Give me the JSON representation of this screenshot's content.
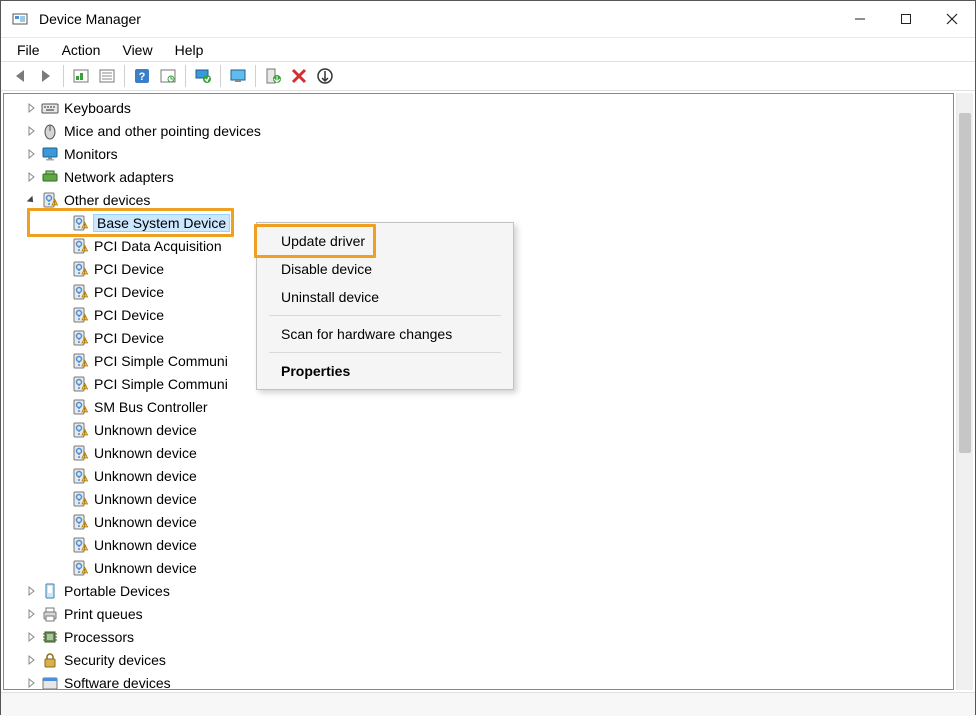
{
  "window": {
    "title": "Device Manager"
  },
  "menu": {
    "items": [
      "File",
      "Action",
      "View",
      "Help"
    ]
  },
  "toolbar": {
    "icons": [
      "back",
      "forward",
      "sep",
      "show-hidden",
      "properties",
      "sep",
      "help",
      "scan",
      "sep",
      "update",
      "sep",
      "add-legacy",
      "sep",
      "enable",
      "uninstall",
      "scan-changes"
    ]
  },
  "tree": {
    "nodes": [
      {
        "label": "Keyboards",
        "icon": "keyboard",
        "expandable": true
      },
      {
        "label": "Mice and other pointing devices",
        "icon": "mouse",
        "expandable": true
      },
      {
        "label": "Monitors",
        "icon": "monitor",
        "expandable": true
      },
      {
        "label": "Network adapters",
        "icon": "network",
        "expandable": true
      },
      {
        "label": "Other devices",
        "icon": "unknown-warn",
        "expandable": true,
        "expanded": true,
        "children": [
          {
            "label": "Base System Device",
            "icon": "unknown-warn",
            "selected": true
          },
          {
            "label": "PCI Data Acquisition",
            "icon": "unknown-warn"
          },
          {
            "label": "PCI Device",
            "icon": "unknown-warn"
          },
          {
            "label": "PCI Device",
            "icon": "unknown-warn"
          },
          {
            "label": "PCI Device",
            "icon": "unknown-warn"
          },
          {
            "label": "PCI Device",
            "icon": "unknown-warn"
          },
          {
            "label": "PCI Simple Communi",
            "icon": "unknown-warn"
          },
          {
            "label": "PCI Simple Communi",
            "icon": "unknown-warn"
          },
          {
            "label": "SM Bus Controller",
            "icon": "unknown-warn"
          },
          {
            "label": "Unknown device",
            "icon": "unknown-warn"
          },
          {
            "label": "Unknown device",
            "icon": "unknown-warn"
          },
          {
            "label": "Unknown device",
            "icon": "unknown-warn"
          },
          {
            "label": "Unknown device",
            "icon": "unknown-warn"
          },
          {
            "label": "Unknown device",
            "icon": "unknown-warn"
          },
          {
            "label": "Unknown device",
            "icon": "unknown-warn"
          },
          {
            "label": "Unknown device",
            "icon": "unknown-warn"
          }
        ]
      },
      {
        "label": "Portable Devices",
        "icon": "portable",
        "expandable": true
      },
      {
        "label": "Print queues",
        "icon": "printer",
        "expandable": true
      },
      {
        "label": "Processors",
        "icon": "cpu",
        "expandable": true
      },
      {
        "label": "Security devices",
        "icon": "lock",
        "expandable": true
      },
      {
        "label": "Software devices",
        "icon": "software",
        "expandable": true,
        "cut": true
      }
    ]
  },
  "context_menu": {
    "items": [
      {
        "label": "Update driver",
        "highlighted": true
      },
      {
        "label": "Disable device"
      },
      {
        "label": "Uninstall device"
      },
      {
        "sep": true
      },
      {
        "label": "Scan for hardware changes"
      },
      {
        "sep": true
      },
      {
        "label": "Properties",
        "bold": true
      }
    ]
  }
}
